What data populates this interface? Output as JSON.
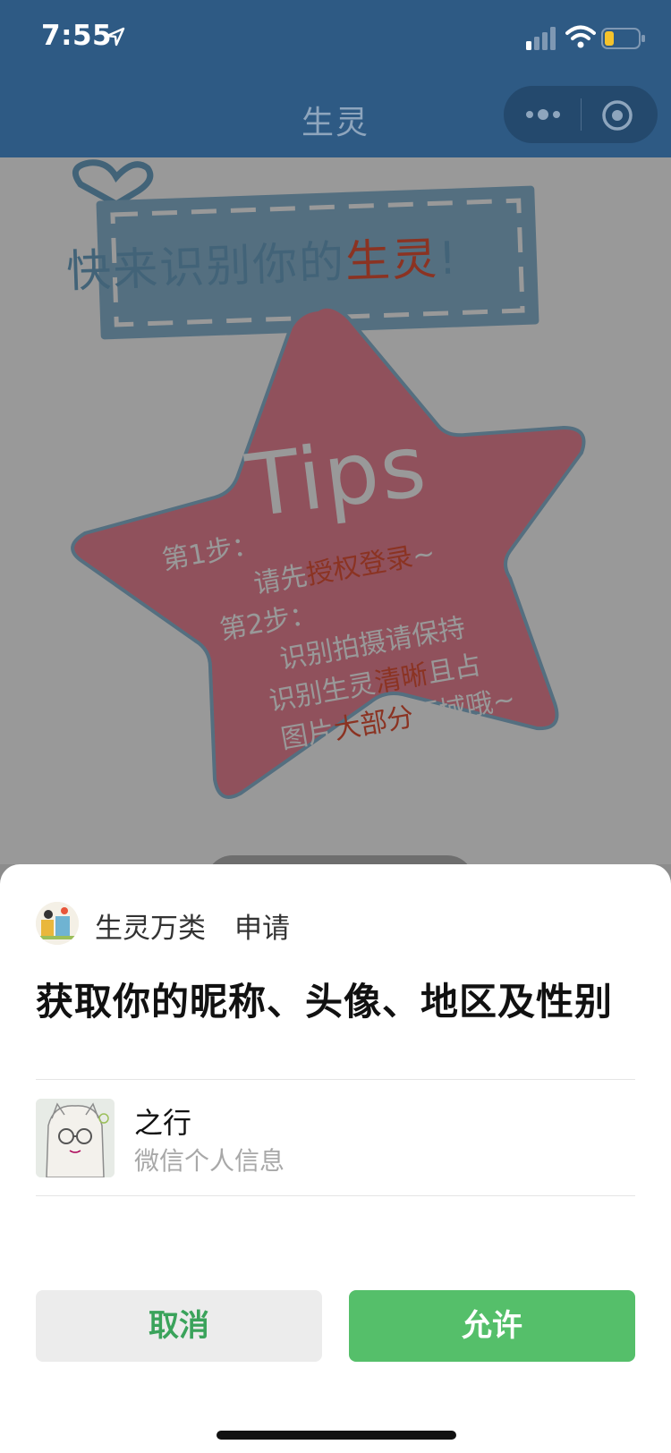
{
  "status_bar": {
    "time": "7:55",
    "icons": [
      "location-arrow-icon",
      "cellular-signal-icon",
      "wifi-icon",
      "battery-icon"
    ],
    "battery_color": "#f5c32c"
  },
  "nav": {
    "title": "生灵",
    "capsule_icons": [
      "more-icon",
      "target-icon"
    ],
    "background": "#2e5a84"
  },
  "content": {
    "banner_prefix": "快来识别你的",
    "banner_highlight": "生灵",
    "banner_suffix": "!",
    "tips_title": "Tips",
    "step1_label": "第1步：",
    "step1_prefix": "请先",
    "step1_highlight": "授权登录",
    "step1_suffix": "~",
    "step2_label": "第2步：",
    "step2_line1": "识别拍摄请保持",
    "step2_line2_prefix": "识别生灵",
    "step2_line2_highlight": "清晰",
    "step2_line2_suffix": "且占",
    "step2_line3_prefix": "图片",
    "step2_line3_highlight": "大部分",
    "step2_line3_suffix": "区域哦~"
  },
  "sheet": {
    "app_name": "生灵万类",
    "action": "申请",
    "title": "获取你的昵称、头像、地区及性别",
    "user_name": "之行",
    "user_sub": "微信个人信息",
    "cancel_label": "取消",
    "allow_label": "允许",
    "accent": "#55bf6a"
  }
}
